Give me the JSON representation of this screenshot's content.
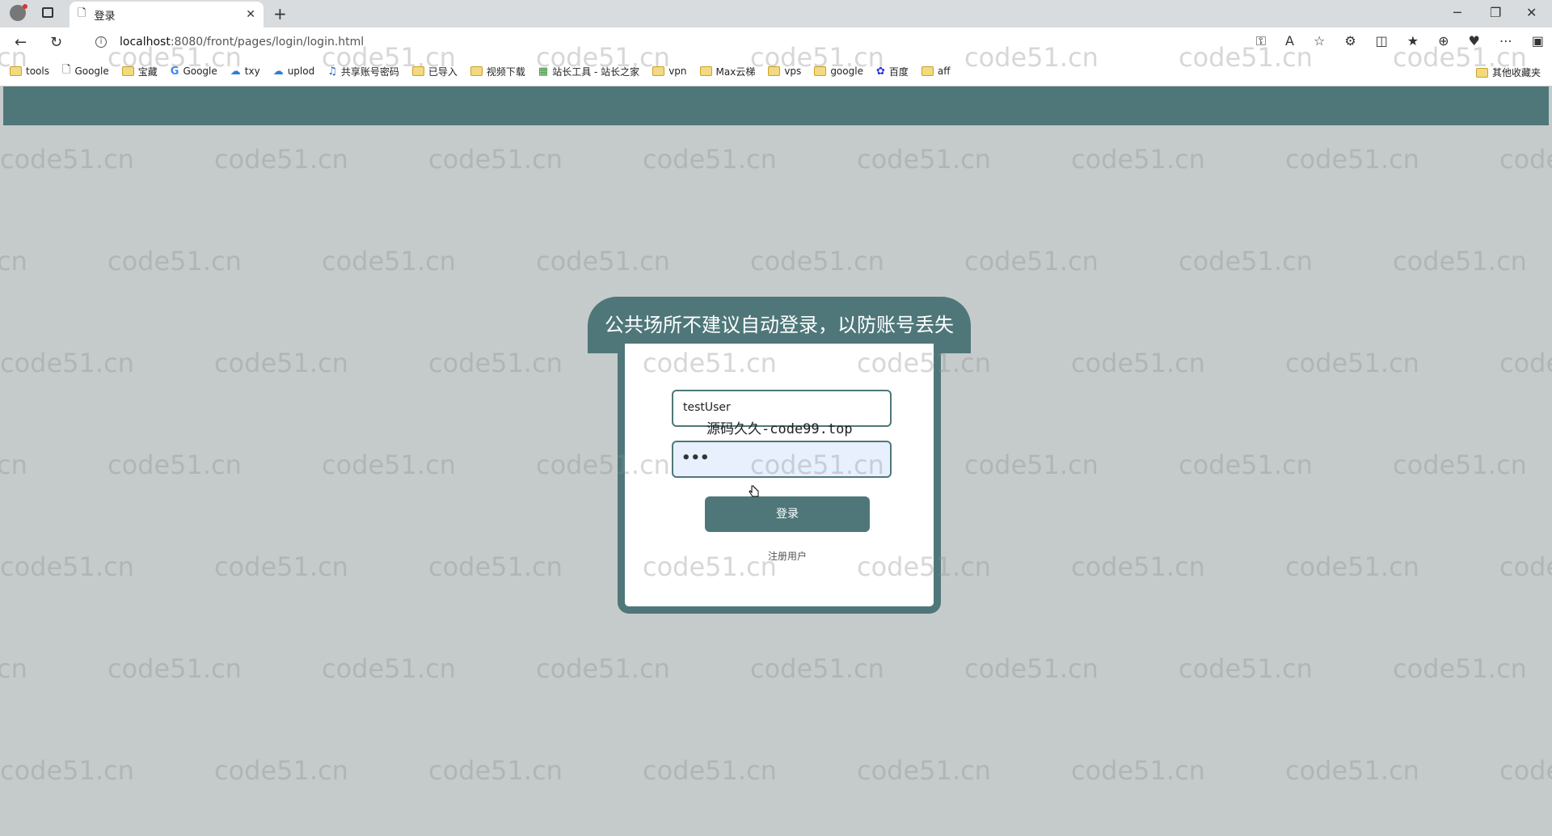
{
  "browser": {
    "tab_title": "登录",
    "url_host": "localhost",
    "url_path": ":8080/front/pages/login/login.html"
  },
  "bookmarks": {
    "items": [
      {
        "label": "tools",
        "icon": "folder"
      },
      {
        "label": "Google",
        "icon": "page"
      },
      {
        "label": "宝藏",
        "icon": "folder"
      },
      {
        "label": "Google",
        "icon": "google"
      },
      {
        "label": "txy",
        "icon": "cloud"
      },
      {
        "label": "uplod",
        "icon": "cloud"
      },
      {
        "label": "共享账号密码",
        "icon": "share"
      },
      {
        "label": "已导入",
        "icon": "folder"
      },
      {
        "label": "视频下载",
        "icon": "folder"
      },
      {
        "label": "站长工具 - 站长之家",
        "icon": "site"
      },
      {
        "label": "vpn",
        "icon": "folder"
      },
      {
        "label": "Max云梯",
        "icon": "folder"
      },
      {
        "label": "vps",
        "icon": "folder"
      },
      {
        "label": "google",
        "icon": "folder"
      },
      {
        "label": "百度",
        "icon": "baidu"
      },
      {
        "label": "aff",
        "icon": "folder"
      }
    ],
    "other": "其他收藏夹"
  },
  "watermark": "code51.cn",
  "login": {
    "banner": "公共场所不建议自动登录，以防账号丢失",
    "username_value": "testUser",
    "overlay_text": "源码久久-code99.top",
    "password_value": "•••",
    "login_button": "登录",
    "register_link": "注册用户"
  },
  "colors": {
    "accent": "#4f7779",
    "page_bg": "#c5cbcb"
  }
}
